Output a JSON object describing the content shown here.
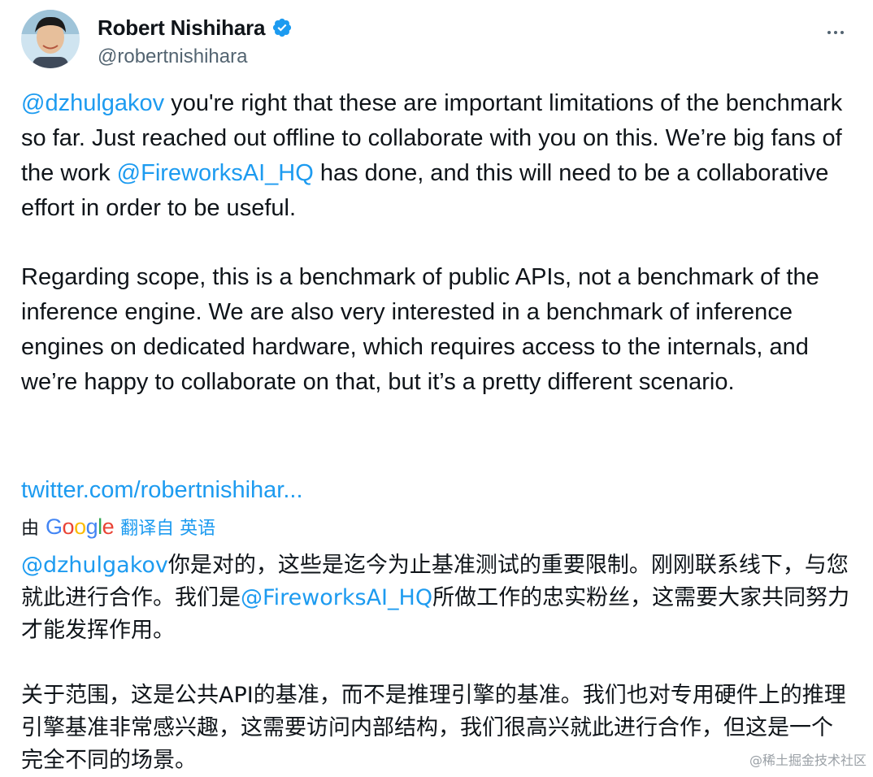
{
  "author": {
    "display_name": "Robert Nishihara",
    "handle": "@robertnishihara",
    "verified_icon": "verified-badge-icon",
    "avatar_icon": "avatar"
  },
  "more_icon": "more-options-icon",
  "tweet": {
    "p1": {
      "mention1": "@dzhulgakov",
      "text1": " you're right that these are important limitations of the benchmark so far. Just reached out offline to collaborate with you on this. We’re big fans of the work ",
      "mention2": "@FireworksAI_HQ",
      "text2": " has done, and this will need to be a collaborative effort in order to be useful."
    },
    "p2": "Regarding scope, this is a benchmark of public APIs, not a benchmark of the inference engine. We are also very interested in a benchmark of inference engines on dedicated hardware, which requires access to the internals, and we’re happy to collaborate on that, but it’s a pretty different scenario.",
    "link": "twitter.com/robertnishihar..."
  },
  "translation": {
    "by": "由",
    "google": [
      "G",
      "o",
      "o",
      "g",
      "l",
      "e"
    ],
    "translated_from": "翻译自 英语",
    "p1": {
      "mention1": "@dzhulgakov",
      "text1": "你是对的，这些是迄今为止基准测试的重要限制。刚刚联系线下，与您就此进行合作。我们是",
      "mention2": "@FireworksAI_HQ",
      "text2": "所做工作的忠实粉丝，这需要大家共同努力才能发挥作用。"
    },
    "p2": "关于范围，这是公共API的基准，而不是推理引擎的基准。我们也对专用硬件上的推理引擎基准非常感兴趣，这需要访问内部结构，我们很高兴就此进行合作，但这是一个完全不同的场景。"
  },
  "watermark": "@稀土掘金技术社区",
  "colors": {
    "link": "#1d9bf0",
    "text": "#0f1419",
    "secondary": "#536471",
    "verified": "#1d9bf0"
  }
}
